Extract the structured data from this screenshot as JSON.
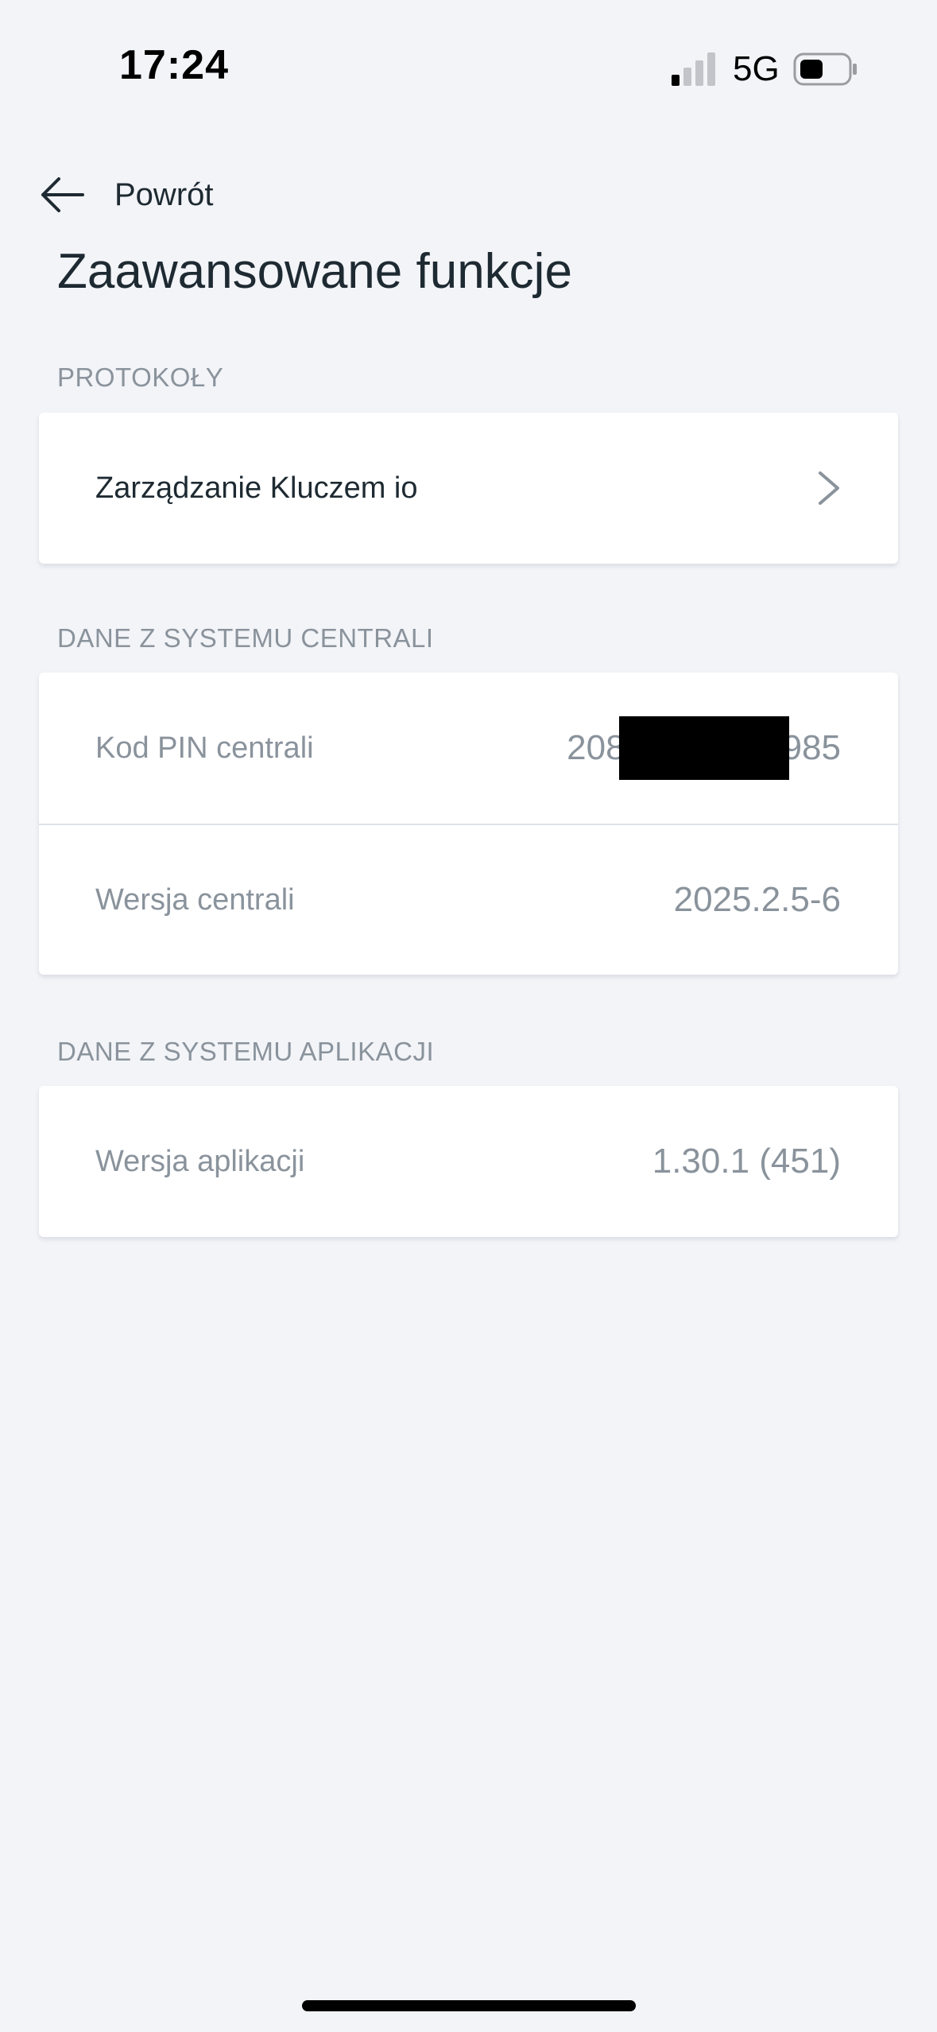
{
  "status_bar": {
    "time": "17:24",
    "network": "5G",
    "signal_icon": "signal-bars-icon",
    "battery_icon": "battery-icon"
  },
  "nav": {
    "back_label": "Powrót",
    "back_icon": "arrow-left-icon"
  },
  "page": {
    "title": "Zaawansowane funkcje"
  },
  "sections": {
    "protocols": {
      "label": "PROTOKOŁY",
      "items": [
        {
          "label": "Zarządzanie Kluczem io",
          "icon": "chevron-right-icon"
        }
      ]
    },
    "hub_data": {
      "label": "DANE Z SYSTEMU CENTRALI",
      "pin": {
        "label": "Kod PIN centrali",
        "value_start": "208",
        "value_end": "985",
        "redacted": true
      },
      "version": {
        "label": "Wersja centrali",
        "value": "2025.2.5-6"
      }
    },
    "app_data": {
      "label": "DANE Z SYSTEMU APLIKACJI",
      "version": {
        "label": "Wersja aplikacji",
        "value": "1.30.1 (451)"
      }
    }
  },
  "colors": {
    "background": "#f3f4f8",
    "text_primary": "#1e2a32",
    "text_secondary": "#8a939c",
    "card": "#ffffff"
  }
}
